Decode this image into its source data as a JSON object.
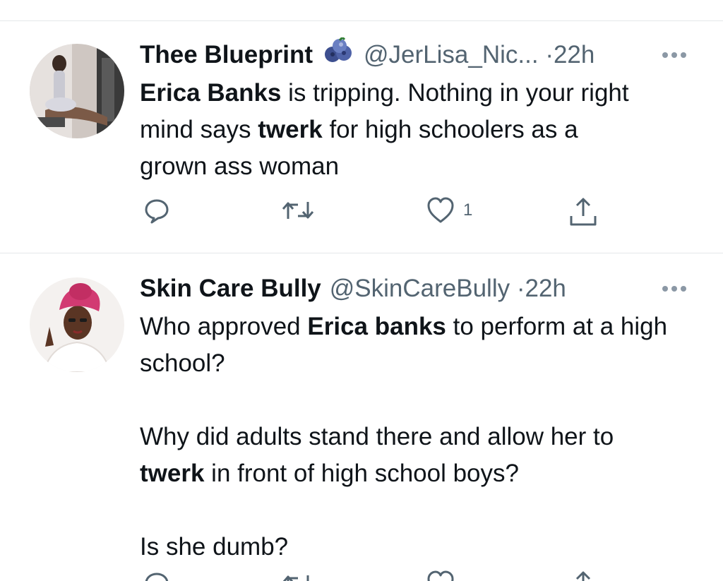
{
  "tweets": [
    {
      "name": "Thee Blueprint",
      "badge_icon": "blueberries-emoji-icon",
      "handle": "@JerLisa_Nic...",
      "dot": "·",
      "time": "22h",
      "text": {
        "l1_bold": "Erica Banks",
        "l1_rest": " is tripping. Nothing in your right",
        "l2_pre": "mind says ",
        "l2_bold": "twerk",
        "l2_rest": " for high schoolers as a",
        "l3": "grown ass woman"
      },
      "actions": {
        "reply_icon": "reply-icon",
        "retweet_icon": "retweet-icon",
        "like_icon": "heart-icon",
        "like_count": "1",
        "share_icon": "share-icon"
      }
    },
    {
      "name": "Skin Care Bully",
      "handle": "@SkinCareBully",
      "dot": "·",
      "time": "22h",
      "text": {
        "p1_pre": "Who approved ",
        "p1_bold": "Erica banks",
        "p1_rest": " to perform at a high school?",
        "p2_pre": "Why did adults stand there and allow her to ",
        "p2_bold": "twerk",
        "p2_rest": " in front of high school boys?",
        "p3": "Is she dumb?"
      }
    }
  ],
  "colors": {
    "text": "#0f1419",
    "secondary": "#536471",
    "divider": "#e4e7ea"
  }
}
